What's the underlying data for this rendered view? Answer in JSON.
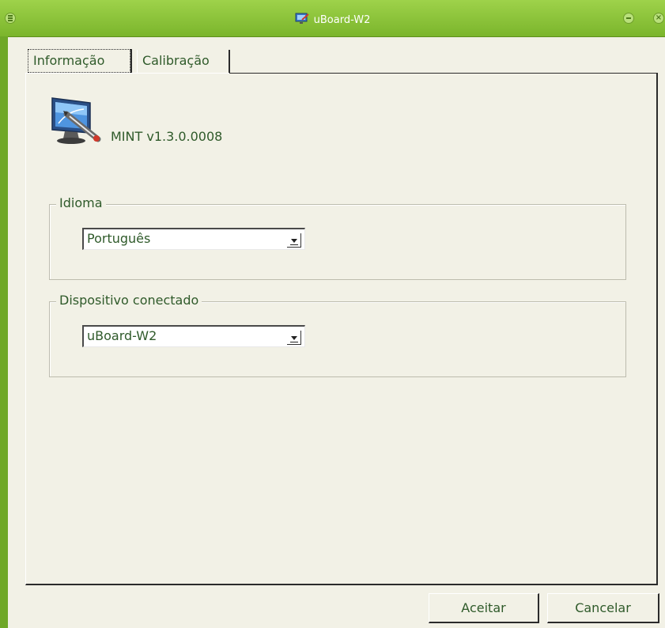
{
  "window": {
    "title": "uBoard-W2",
    "app_icon": "monitor-pen-icon",
    "controls": [
      "menu-icon",
      "minimize-icon",
      "close-icon"
    ]
  },
  "tabs": [
    {
      "label": "Informação",
      "active": true
    },
    {
      "label": "Calibração",
      "active": false
    }
  ],
  "info": {
    "logo_icon": "monitor-pen-icon",
    "version": "MINT v1.3.0.0008"
  },
  "language_group": {
    "legend": "Idioma",
    "selected": "Português"
  },
  "device_group": {
    "legend": "Dispositivo conectado",
    "selected": "uBoard-W2"
  },
  "buttons": {
    "accept": "Aceitar",
    "cancel": "Cancelar"
  },
  "colors": {
    "titlebar": "#8cc43c",
    "text": "#2f5a2a",
    "background": "#f2f1e6"
  }
}
